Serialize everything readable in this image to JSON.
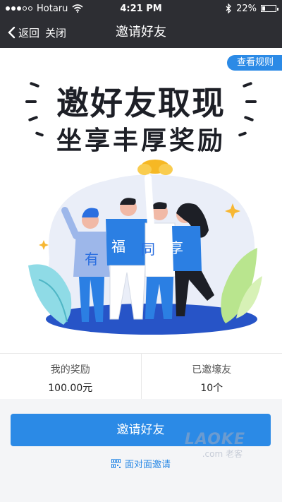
{
  "status_bar": {
    "carrier": "Hotaru",
    "time": "4:21 PM",
    "battery": "22%",
    "battery_level": 0.22
  },
  "nav": {
    "back_label": "返回",
    "close_label": "关闭",
    "title": "邀请好友"
  },
  "hero": {
    "rules_label": "查看规则",
    "headline_line1": "邀好友取现",
    "headline_line2": "坐享丰厚奖励",
    "shirt_chars": [
      "有",
      "福",
      "同",
      "享"
    ]
  },
  "stats": {
    "reward_label": "我的奖励",
    "reward_value": "100.00元",
    "invited_label": "已邀壕友",
    "invited_value": "10个"
  },
  "actions": {
    "invite_label": "邀请好友",
    "face_to_face_label": "面对面邀请"
  },
  "watermark": {
    "main": "LAOKE",
    "sub": ".com 老客"
  },
  "colors": {
    "accent": "#2b8ae6",
    "nav_bg": "#2d2e33",
    "headline": "#1d1f26"
  }
}
